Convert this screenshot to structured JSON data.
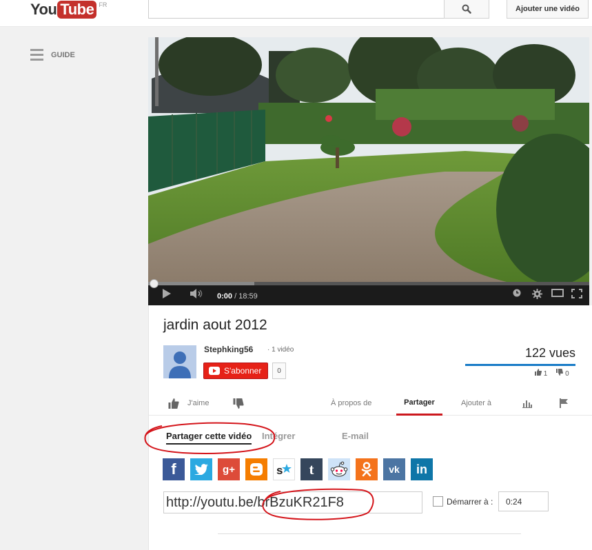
{
  "header": {
    "logo_you": "You",
    "logo_tube": "Tube",
    "logo_country": "FR",
    "search_placeholder": "",
    "upload_label": "Ajouter une vidéo"
  },
  "guide": {
    "label": "GUIDE"
  },
  "player": {
    "current_time": "0:00",
    "duration": "/ 18:59",
    "loaded_fraction": 0.24
  },
  "video": {
    "title": "jardin aout 2012",
    "channel": "Stephking56",
    "video_count": "· 1 vidéo",
    "subscribe_label": "S'abonner",
    "subscriber_count": "0",
    "views": "122 vues",
    "likes": "1",
    "dislikes": "0"
  },
  "actions": {
    "like_label": "J'aime",
    "about_label": "À propos de",
    "share_label": "Partager",
    "add_label": "Ajouter à"
  },
  "share": {
    "tabs": [
      "Partager cette vidéo",
      "Intégrer",
      "E-mail"
    ],
    "url": "http://youtu.be/brBzuKR21F8",
    "start_label": "Démarrer à :",
    "start_time": "0:24",
    "networks": [
      "facebook",
      "twitter",
      "google-plus",
      "blogger",
      "stumbleupon",
      "tumblr",
      "reddit",
      "odnoklassniki",
      "vkontakte",
      "linkedin"
    ]
  },
  "colors": {
    "accent_red": "#cc181e",
    "annotation": "#d4141a",
    "facebook": "#3b5998",
    "twitter": "#2ba9e1",
    "google_plus": "#dd4b39",
    "blogger": "#f57d00",
    "tumblr": "#35465c",
    "odnoklassniki": "#f4731c",
    "vkontakte": "#4c75a3",
    "linkedin": "#0e76a8"
  }
}
